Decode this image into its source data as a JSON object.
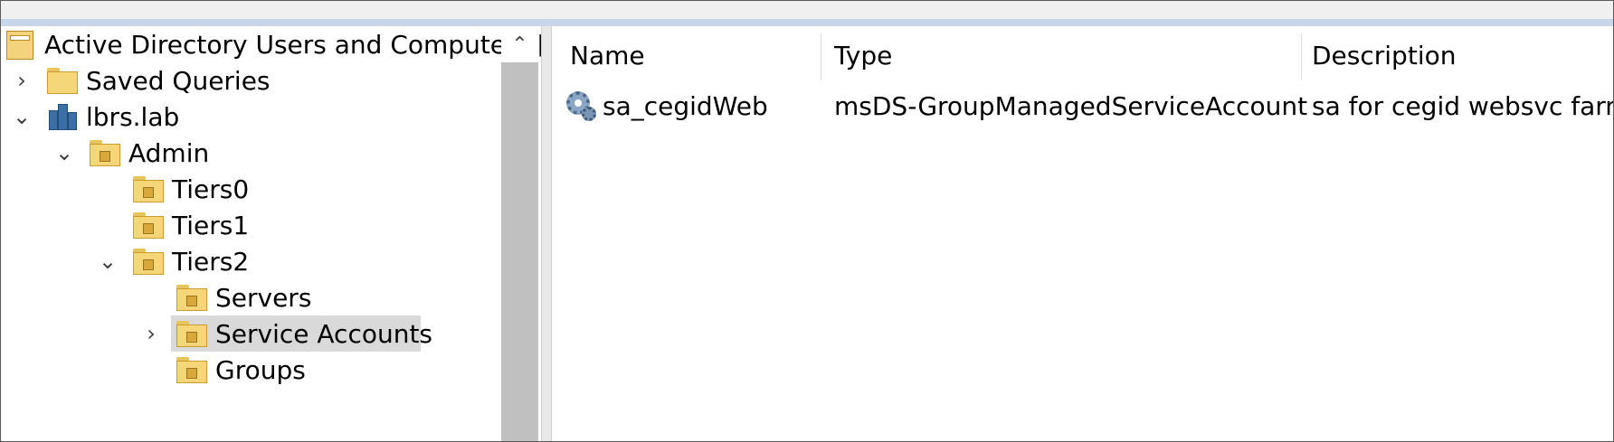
{
  "tree": {
    "root_label": "Active Directory Users and Computers [l",
    "saved_queries_label": "Saved Queries",
    "domain_label": "lbrs.lab",
    "admin_label": "Admin",
    "tiers0_label": "Tiers0",
    "tiers1_label": "Tiers1",
    "tiers2_label": "Tiers2",
    "servers_label": "Servers",
    "service_accounts_label": "Service Accounts",
    "groups_label": "Groups",
    "scroll_up_glyph": "⌃"
  },
  "list": {
    "columns": [
      "Name",
      "Type",
      "Description"
    ],
    "rows": [
      {
        "name": "sa_cegidWeb",
        "type": "msDS-GroupManagedServiceAccount",
        "description": "sa for cegid websvc farm",
        "icon": "gmsa-gear-icon"
      }
    ]
  },
  "colors": {
    "selection": "#d9d9d9",
    "scrollbar": "#c0c0c0",
    "topbar": "#c7d6e8"
  }
}
